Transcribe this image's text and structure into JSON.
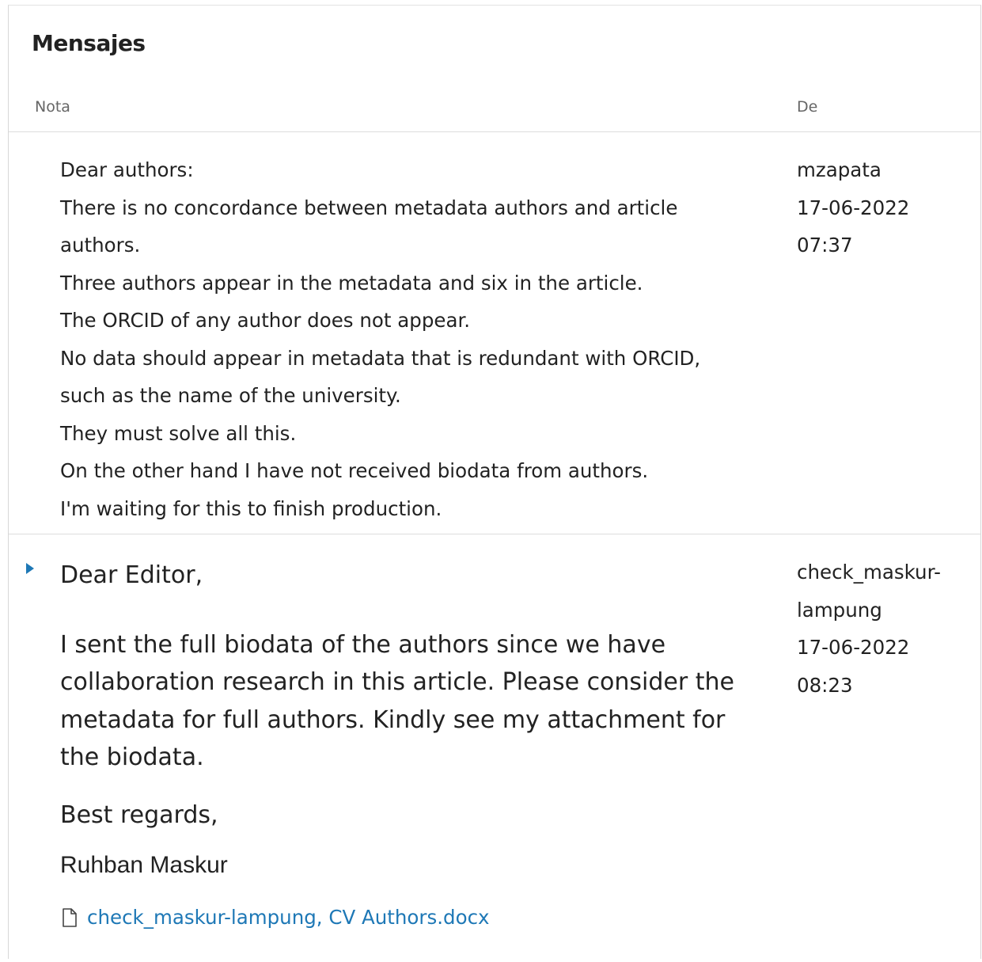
{
  "panel": {
    "title": "Mensajes",
    "columns": {
      "note": "Nota",
      "from": "De"
    }
  },
  "messages": [
    {
      "lines": [
        "Dear authors:",
        "There is no concordance between metadata authors and article",
        "authors.",
        "Three authors appear in the metadata and six in the article.",
        "The ORCID of any author does not appear.",
        "No data should appear in metadata that is redundant with ORCID,",
        "such as the name of the university.",
        "They must solve all this.",
        "On the other hand I have not received biodata from authors.",
        "I'm waiting for this to finish production."
      ],
      "from": "mzapata",
      "date": "17-06-2022",
      "time": "07:37"
    },
    {
      "greeting": "Dear Editor,",
      "body": "I sent the full biodata of the authors since we have collaboration research in this article. Please consider the metadata for full authors. Kindly see my attachment for the biodata.",
      "closing": "Best regards,",
      "signature": "Ruhban Maskur",
      "attachment": "check_maskur-lampung, CV Authors.docx",
      "from_line1": "check_maskur-",
      "from_line2": "lampung",
      "date": "17-06-2022",
      "time": "08:23"
    }
  ],
  "icons": {
    "toggle": "caret-right-icon",
    "attachment": "file-icon"
  },
  "colors": {
    "link": "#1e78b6",
    "text": "#222222",
    "muted": "#666666",
    "border": "#dddddd"
  }
}
